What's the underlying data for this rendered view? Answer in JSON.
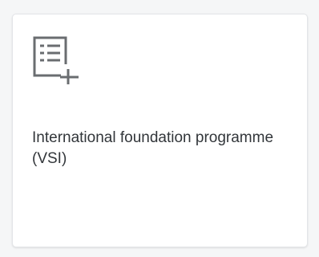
{
  "tile": {
    "icon": "document-list-add-icon",
    "title": "International foundation programme (VSI)",
    "icon_color": "#6a6d70",
    "text_color": "#32363a",
    "background": "#ffffff"
  }
}
